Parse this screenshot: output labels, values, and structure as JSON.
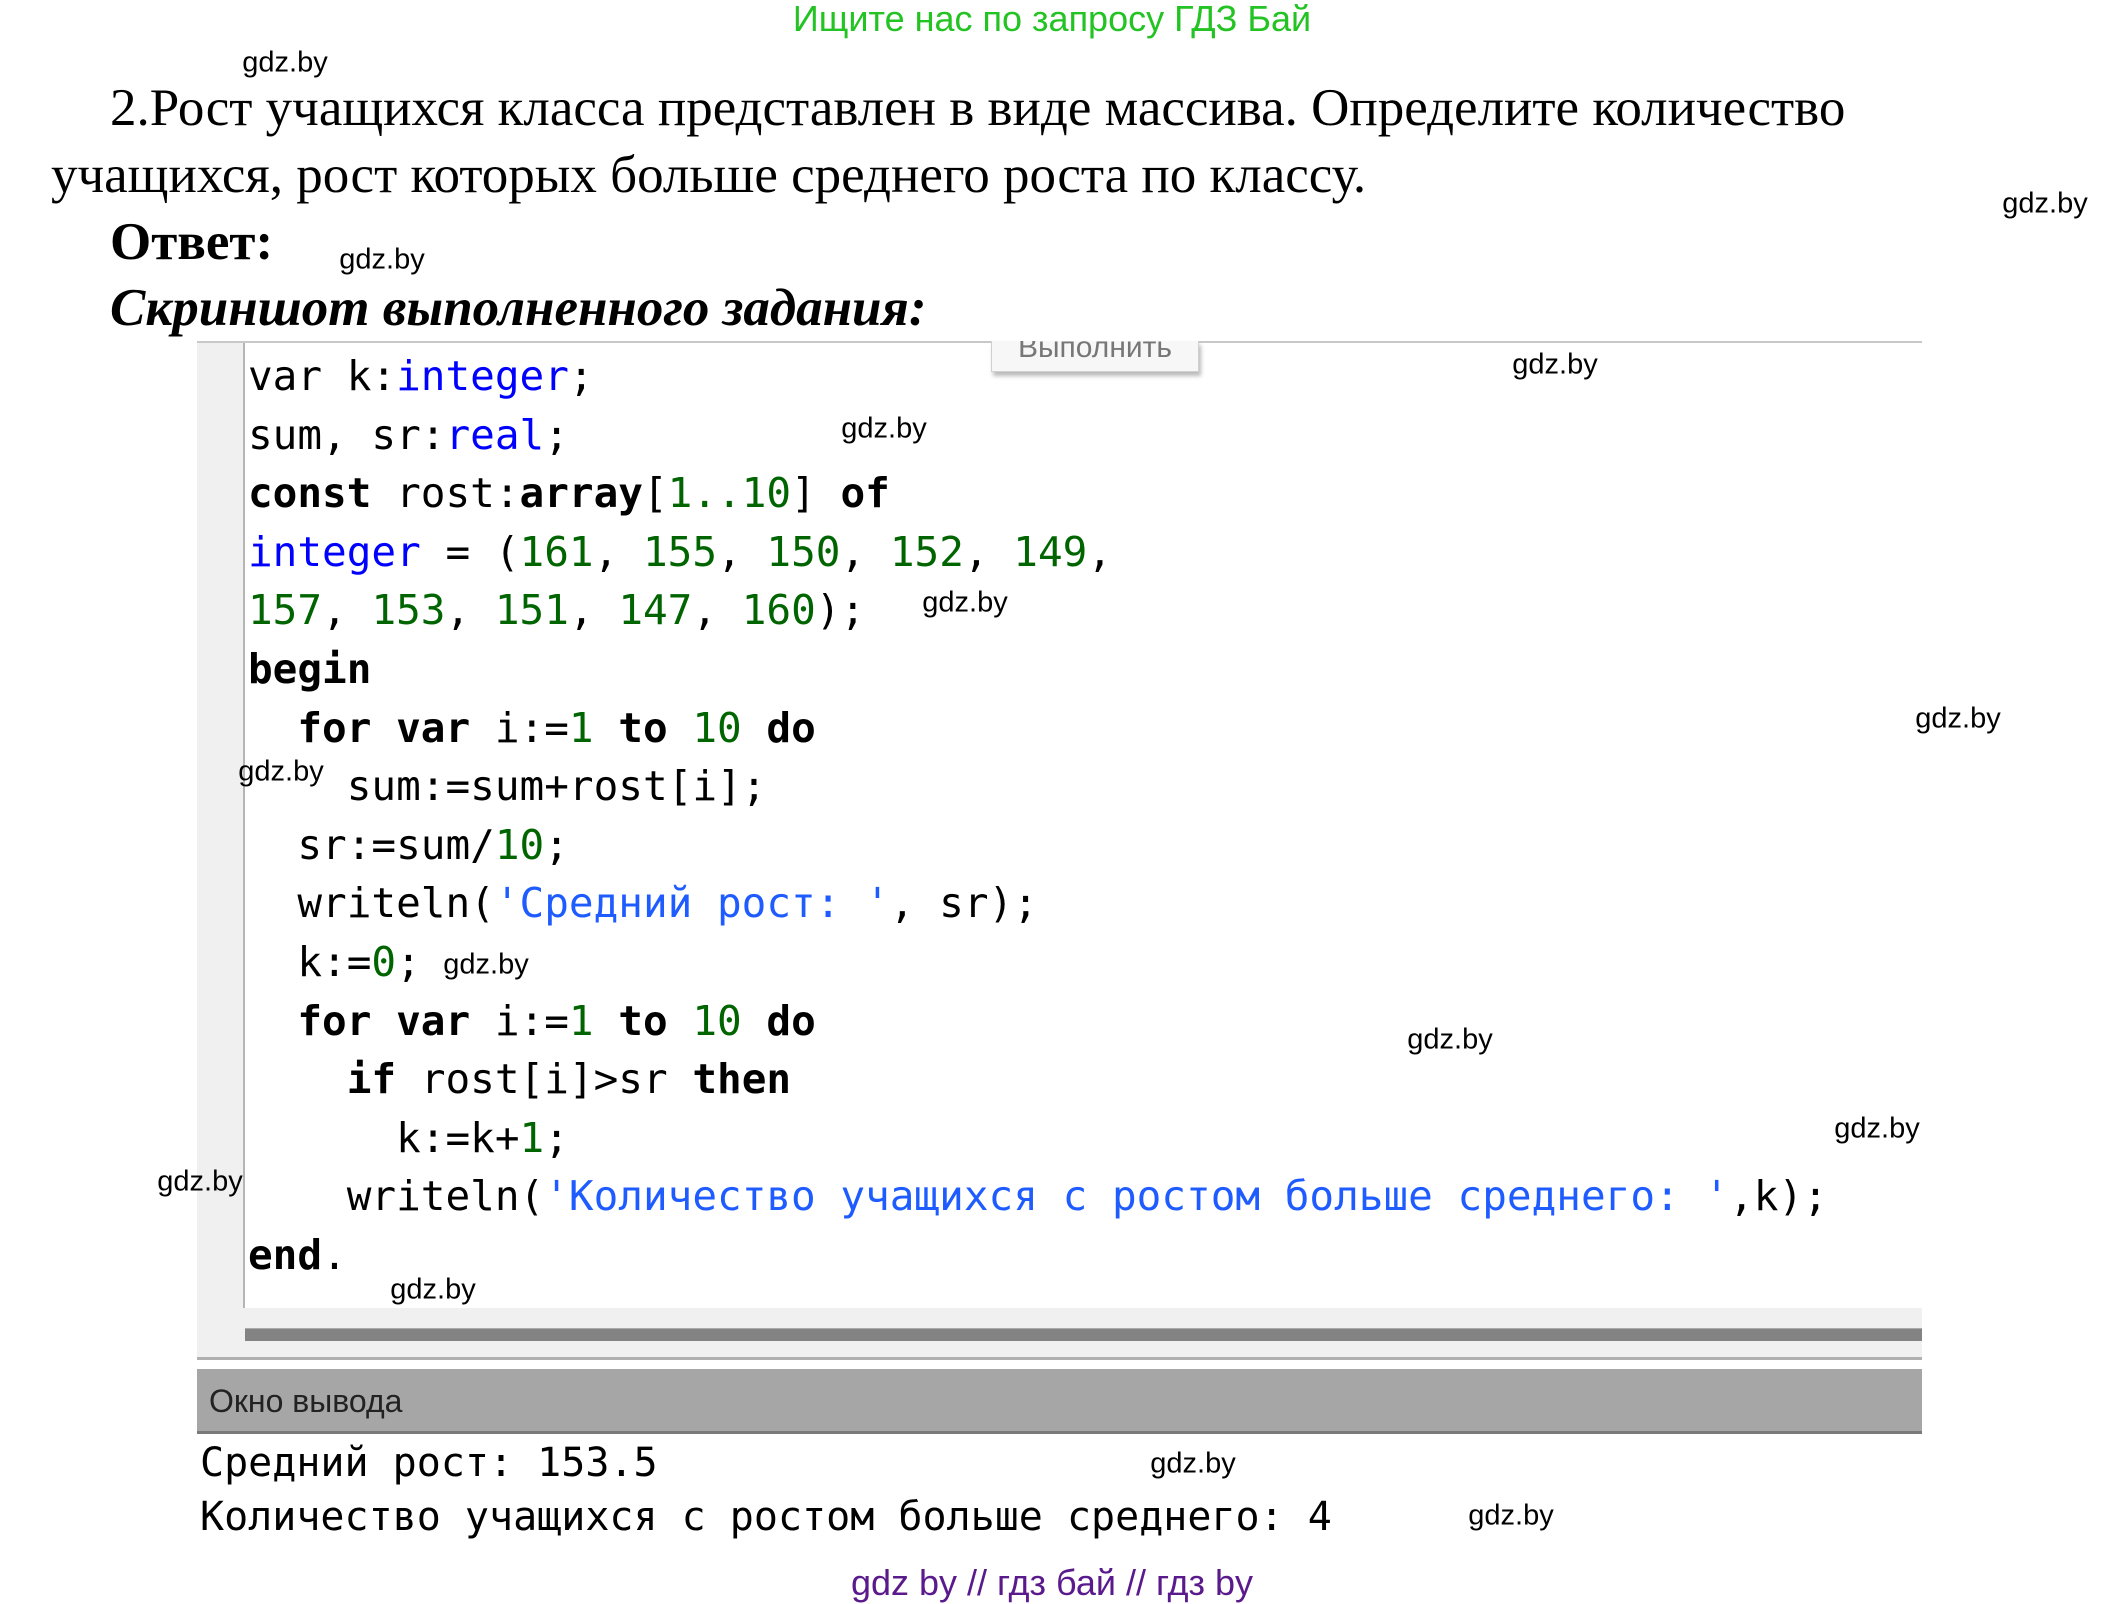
{
  "banner": "Ищите нас по запросу ГДЗ Бай",
  "task": {
    "line1": "2.Рост учащихся класса представлен в виде массива. Определите количество",
    "line2": "учащихся, рост которых больше среднего роста по классу."
  },
  "answer_label": "Ответ:",
  "screenshot_label": "Скриншот выполненного задания:",
  "editor": {
    "run_button": "Выполнить",
    "code": [
      [
        [
          "var ",
          "id"
        ],
        [
          "k:",
          "id"
        ],
        [
          "integer",
          "ty"
        ],
        [
          ";",
          "id"
        ]
      ],
      [
        [
          "sum, sr:",
          "id"
        ],
        [
          "real",
          "ty"
        ],
        [
          ";",
          "id"
        ]
      ],
      [
        [
          "const ",
          "kw"
        ],
        [
          "rost:",
          "id"
        ],
        [
          "array",
          "kw"
        ],
        [
          "[",
          "id"
        ],
        [
          "1..10",
          "num"
        ],
        [
          "] ",
          "id"
        ],
        [
          "of",
          "kw"
        ]
      ],
      [
        [
          "integer",
          "ty"
        ],
        [
          " = (",
          "id"
        ],
        [
          "161",
          "num"
        ],
        [
          ", ",
          "id"
        ],
        [
          "155",
          "num"
        ],
        [
          ", ",
          "id"
        ],
        [
          "150",
          "num"
        ],
        [
          ", ",
          "id"
        ],
        [
          "152",
          "num"
        ],
        [
          ", ",
          "id"
        ],
        [
          "149",
          "num"
        ],
        [
          ",",
          "id"
        ]
      ],
      [
        [
          "157",
          "num"
        ],
        [
          ", ",
          "id"
        ],
        [
          "153",
          "num"
        ],
        [
          ", ",
          "id"
        ],
        [
          "151",
          "num"
        ],
        [
          ", ",
          "id"
        ],
        [
          "147",
          "num"
        ],
        [
          ", ",
          "id"
        ],
        [
          "160",
          "num"
        ],
        [
          ");",
          "id"
        ]
      ],
      [
        [
          "begin",
          "kw"
        ]
      ],
      [
        [
          "  ",
          "id"
        ],
        [
          "for var ",
          "kw"
        ],
        [
          "i:=",
          "id"
        ],
        [
          "1",
          "num"
        ],
        [
          " to ",
          "kw"
        ],
        [
          "10",
          "num"
        ],
        [
          " do",
          "kw"
        ]
      ],
      [
        [
          "    sum:=sum+rost[i];",
          "id"
        ]
      ],
      [
        [
          "  sr:=sum/",
          "id"
        ],
        [
          "10",
          "num"
        ],
        [
          ";",
          "id"
        ]
      ],
      [
        [
          "  writeln(",
          "id"
        ],
        [
          "'Средний рост: '",
          "str"
        ],
        [
          ", sr);",
          "id"
        ]
      ],
      [
        [
          "  k:=",
          "id"
        ],
        [
          "0",
          "num"
        ],
        [
          ";",
          "id"
        ]
      ],
      [
        [
          "  ",
          "id"
        ],
        [
          "for var ",
          "kw"
        ],
        [
          "i:=",
          "id"
        ],
        [
          "1",
          "num"
        ],
        [
          " to ",
          "kw"
        ],
        [
          "10",
          "num"
        ],
        [
          " do",
          "kw"
        ]
      ],
      [
        [
          "    ",
          "id"
        ],
        [
          "if ",
          "kw"
        ],
        [
          "rost[i]>sr ",
          "id"
        ],
        [
          "then",
          "kw"
        ]
      ],
      [
        [
          "      k:=k+",
          "id"
        ],
        [
          "1",
          "num"
        ],
        [
          ";",
          "id"
        ]
      ],
      [
        [
          "    writeln(",
          "id"
        ],
        [
          "'Количество учащихся с ростом больше среднего: '",
          "str"
        ],
        [
          ",k);",
          "id"
        ]
      ],
      [
        [
          "end",
          "kw"
        ],
        [
          ".",
          "id"
        ]
      ]
    ]
  },
  "output": {
    "title": "Окно вывода",
    "lines": [
      "Средний рост: 153.5",
      "Количество учащихся с ростом больше среднего: 4"
    ]
  },
  "watermark": "gdz.by",
  "footer": "gdz by  //  гдз бай  //  гдз by"
}
